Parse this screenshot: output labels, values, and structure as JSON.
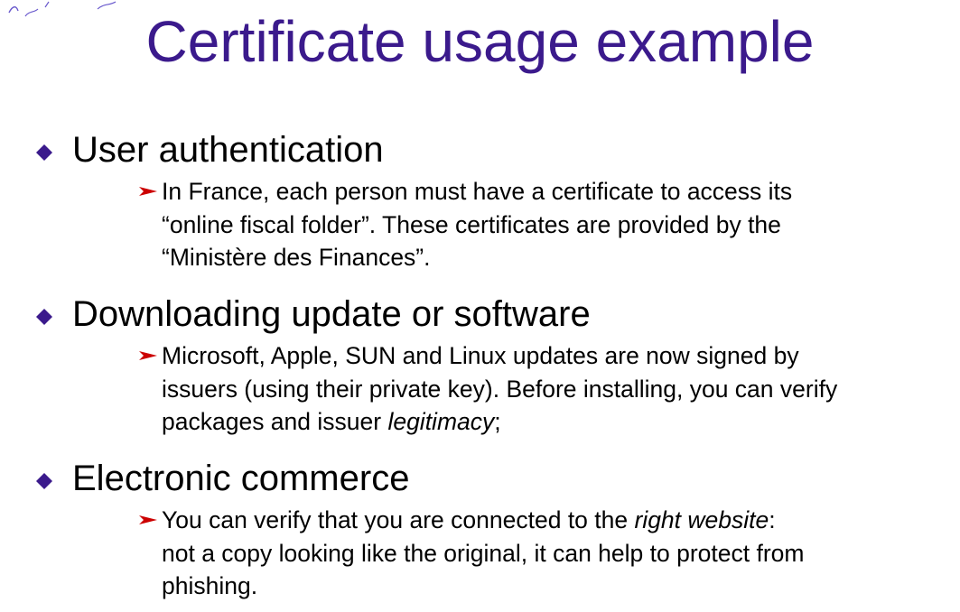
{
  "slide": {
    "title": "Certificate usage example",
    "colors": {
      "title": "#3b1a8c",
      "bullet": "#3b1a8c",
      "arrow": "#cc0000",
      "body_text": "#000000"
    },
    "icons": {
      "bullet": "diamond-bullet-icon",
      "sub_bullet": "red-arrow-icon"
    }
  },
  "sections": [
    {
      "heading": "User authentication",
      "lines": [
        {
          "parts": [
            {
              "text": "In France, each person must have a certificate to access its",
              "italic": false
            }
          ]
        },
        {
          "parts": [
            {
              "text": "“online fiscal folder”. These certificates are provided by the",
              "italic": false
            }
          ]
        },
        {
          "parts": [
            {
              "text": "“Ministère des Finances”.",
              "italic": false
            }
          ]
        }
      ]
    },
    {
      "heading": "Downloading update or software",
      "lines": [
        {
          "parts": [
            {
              "text": "Microsoft, Apple, SUN and Linux updates are now signed by",
              "italic": false
            }
          ]
        },
        {
          "parts": [
            {
              "text": "issuers (using their private key). Before installing, you can verify",
              "italic": false
            }
          ]
        },
        {
          "parts": [
            {
              "text": "packages and issuer ",
              "italic": false
            },
            {
              "text": "legitimacy",
              "italic": true
            },
            {
              "text": ";",
              "italic": false
            }
          ]
        }
      ]
    },
    {
      "heading": "Electronic commerce",
      "lines": [
        {
          "parts": [
            {
              "text": "You can verify that you are connected to the ",
              "italic": false
            },
            {
              "text": "right website",
              "italic": true
            },
            {
              "text": ":",
              "italic": false
            }
          ]
        },
        {
          "parts": [
            {
              "text": "not a copy looking like the original, it can help to protect from",
              "italic": false
            }
          ]
        },
        {
          "parts": [
            {
              "text": "phishing.",
              "italic": false
            }
          ]
        }
      ]
    }
  ]
}
